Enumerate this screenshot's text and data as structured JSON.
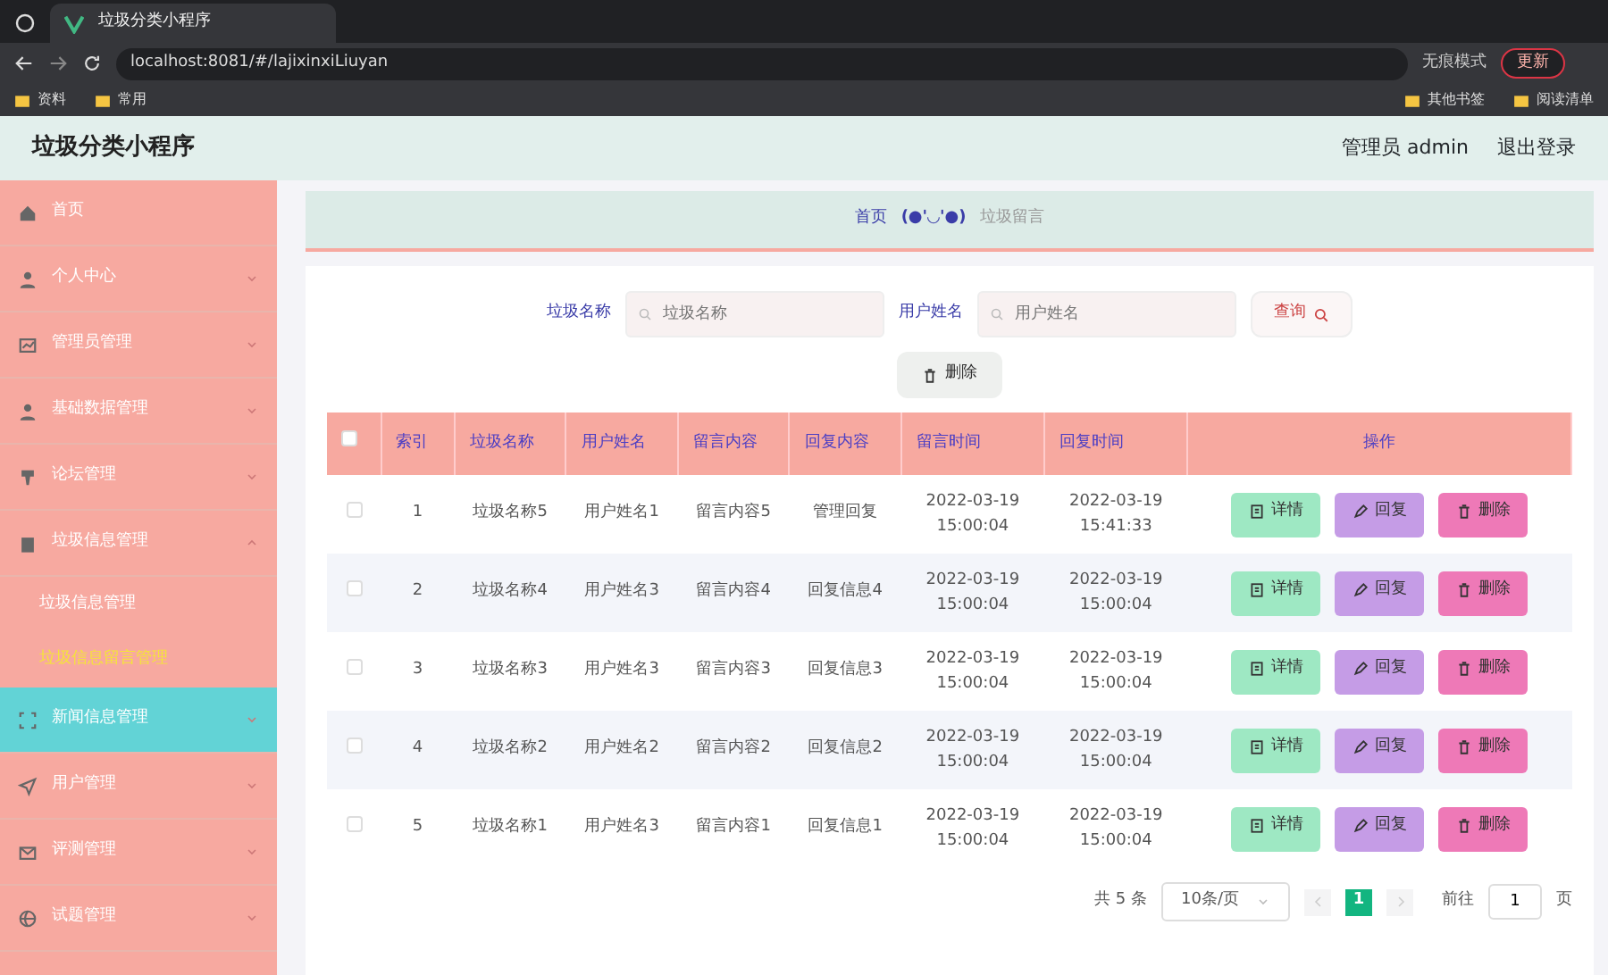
{
  "browser": {
    "tab_title": "垃圾分类小程序",
    "url": "localhost:8081/#/lajixinxiLiuyan",
    "profile": "无痕模式",
    "update_button": "更新",
    "bookmarks": [
      "资料",
      "常用"
    ],
    "bookmarks_right": [
      "其他书签",
      "阅读清单"
    ]
  },
  "header": {
    "title": "垃圾分类小程序",
    "user": "管理员 admin",
    "logout": "退出登录"
  },
  "sidebar": {
    "items": [
      {
        "label": "首页",
        "hovered": false
      },
      {
        "label": "个人中心",
        "expanded": false,
        "hovered": false
      },
      {
        "label": "管理员管理",
        "expanded": false,
        "hovered": false
      },
      {
        "label": "基础数据管理",
        "expanded": false,
        "hovered": false
      },
      {
        "label": "论坛管理",
        "expanded": false,
        "hovered": false
      },
      {
        "label": "垃圾信息管理",
        "expanded": true,
        "hovered": false,
        "children": [
          {
            "label": "垃圾信息管理",
            "selected": false
          },
          {
            "label": "垃圾信息留言管理",
            "selected": true
          }
        ]
      },
      {
        "label": "新闻信息管理",
        "expanded": false,
        "hovered": true
      },
      {
        "label": "用户管理",
        "expanded": false,
        "hovered": false
      },
      {
        "label": "评测管理",
        "expanded": false,
        "hovered": false
      },
      {
        "label": "试题管理",
        "expanded": false,
        "hovered": false
      }
    ]
  },
  "breadcrumb": {
    "home": "首页",
    "face": "(●'◡'●)",
    "current": "垃圾留言"
  },
  "search": [
    {
      "label": "垃圾名称",
      "placeholder": "垃圾名称"
    },
    {
      "label": "用户姓名",
      "placeholder": "用户姓名"
    }
  ],
  "query_button": "查询",
  "delete_button": "删除",
  "table": {
    "all_checked": false,
    "columns": [
      "索引",
      "垃圾名称",
      "用户姓名",
      "留言内容",
      "回复内容",
      "留言时间",
      "回复时间",
      "操作"
    ],
    "rows": [
      {
        "checked": false,
        "cells": [
          "1",
          "垃圾名称5",
          "用户姓名1",
          "留言内容5",
          "管理回复",
          "2022-03-19 15:00:04",
          "2022-03-19 15:41:33"
        ],
        "actions": [
          {
            "kind": "detail",
            "label": "详情"
          },
          {
            "kind": "reply",
            "label": "回复"
          },
          {
            "kind": "delete",
            "label": "删除"
          }
        ]
      },
      {
        "checked": false,
        "cells": [
          "2",
          "垃圾名称4",
          "用户姓名3",
          "留言内容4",
          "回复信息4",
          "2022-03-19 15:00:04",
          "2022-03-19 15:00:04"
        ],
        "actions": [
          {
            "kind": "detail",
            "label": "详情"
          },
          {
            "kind": "reply",
            "label": "回复"
          },
          {
            "kind": "delete",
            "label": "删除"
          }
        ]
      },
      {
        "checked": false,
        "cells": [
          "3",
          "垃圾名称3",
          "用户姓名3",
          "留言内容3",
          "回复信息3",
          "2022-03-19 15:00:04",
          "2022-03-19 15:00:04"
        ],
        "actions": [
          {
            "kind": "detail",
            "label": "详情"
          },
          {
            "kind": "reply",
            "label": "回复"
          },
          {
            "kind": "delete",
            "label": "删除"
          }
        ]
      },
      {
        "checked": false,
        "cells": [
          "4",
          "垃圾名称2",
          "用户姓名2",
          "留言内容2",
          "回复信息2",
          "2022-03-19 15:00:04",
          "2022-03-19 15:00:04"
        ],
        "actions": [
          {
            "kind": "detail",
            "label": "详情"
          },
          {
            "kind": "reply",
            "label": "回复"
          },
          {
            "kind": "delete",
            "label": "删除"
          }
        ]
      },
      {
        "checked": false,
        "cells": [
          "5",
          "垃圾名称1",
          "用户姓名3",
          "留言内容1",
          "回复信息1",
          "2022-03-19 15:00:04",
          "2022-03-19 15:00:04"
        ],
        "actions": [
          {
            "kind": "detail",
            "label": "详情"
          },
          {
            "kind": "reply",
            "label": "回复"
          },
          {
            "kind": "delete",
            "label": "删除"
          }
        ]
      }
    ]
  },
  "pagination": {
    "total": "共 5 条",
    "page_size": "10条/页",
    "pages": [
      {
        "label": "1",
        "selected": true
      }
    ],
    "goto": "前往",
    "goto_value": "1",
    "page_unit": "页"
  }
}
